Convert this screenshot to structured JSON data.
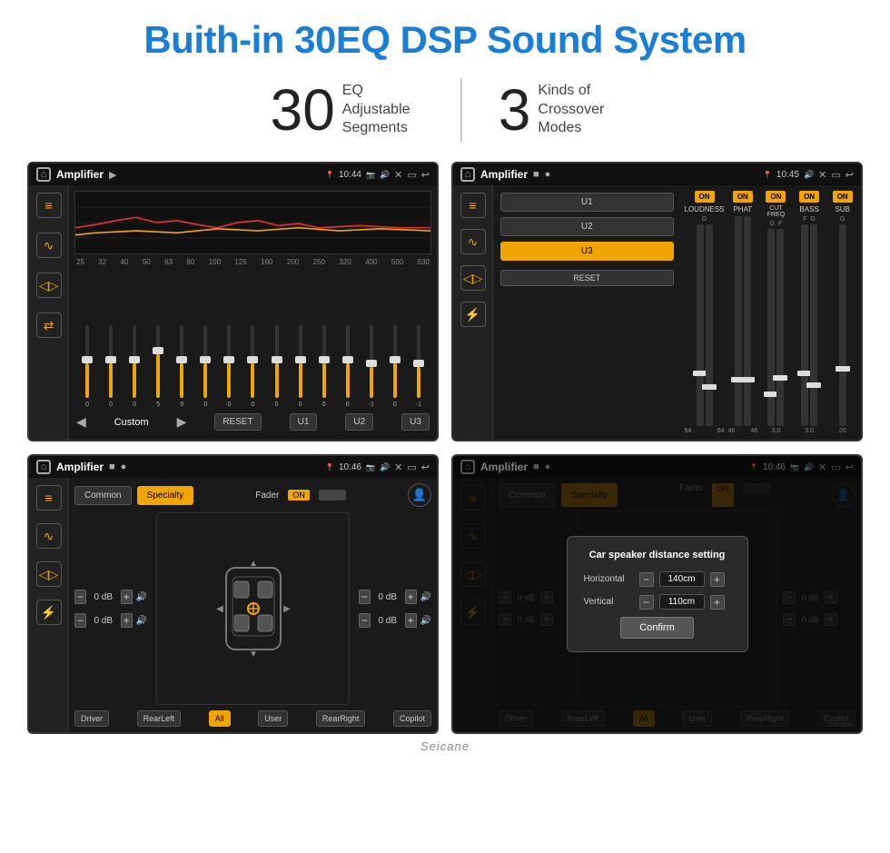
{
  "title": "Buith-in 30EQ DSP Sound System",
  "stats": {
    "eq_number": "30",
    "eq_label": "EQ Adjustable\nSegments",
    "crossover_number": "3",
    "crossover_label": "Kinds of\nCrossover Modes"
  },
  "screens": {
    "eq": {
      "title": "Amplifier",
      "time": "10:44",
      "freq_labels": [
        "25",
        "32",
        "40",
        "50",
        "63",
        "80",
        "100",
        "125",
        "160",
        "200",
        "250",
        "320",
        "400",
        "500",
        "630"
      ],
      "slider_values": [
        "0",
        "0",
        "0",
        "5",
        "0",
        "0",
        "0",
        "0",
        "0",
        "0",
        "0",
        "0",
        "-1",
        "0",
        "-1"
      ],
      "preset": "Custom",
      "buttons": [
        "RESET",
        "U1",
        "U2",
        "U3"
      ]
    },
    "crossover": {
      "title": "Amplifier",
      "time": "10:45",
      "u_buttons": [
        "U1",
        "U2",
        "U3"
      ],
      "active_u": "U3",
      "channels": [
        "LOUDNESS",
        "PHAT",
        "CUT FREQ",
        "BASS",
        "SUB"
      ],
      "on_states": [
        true,
        true,
        true,
        true,
        true
      ],
      "reset_label": "RESET"
    },
    "balance": {
      "title": "Amplifier",
      "time": "10:46",
      "tabs": [
        "Common",
        "Specialty"
      ],
      "active_tab": "Specialty",
      "fader_label": "Fader",
      "fader_on": "ON",
      "db_values": [
        "0 dB",
        "0 dB",
        "0 dB",
        "0 dB"
      ],
      "seat_buttons": [
        "Driver",
        "RearLeft",
        "All",
        "User",
        "RearRight",
        "Copilot"
      ],
      "active_seat": "All"
    },
    "distance": {
      "title": "Amplifier",
      "time": "10:46",
      "dialog_title": "Car speaker distance setting",
      "horizontal_label": "Horizontal",
      "horizontal_value": "140cm",
      "vertical_label": "Vertical",
      "vertical_value": "110cm",
      "confirm_label": "Confirm"
    }
  },
  "brand": "Seicane"
}
